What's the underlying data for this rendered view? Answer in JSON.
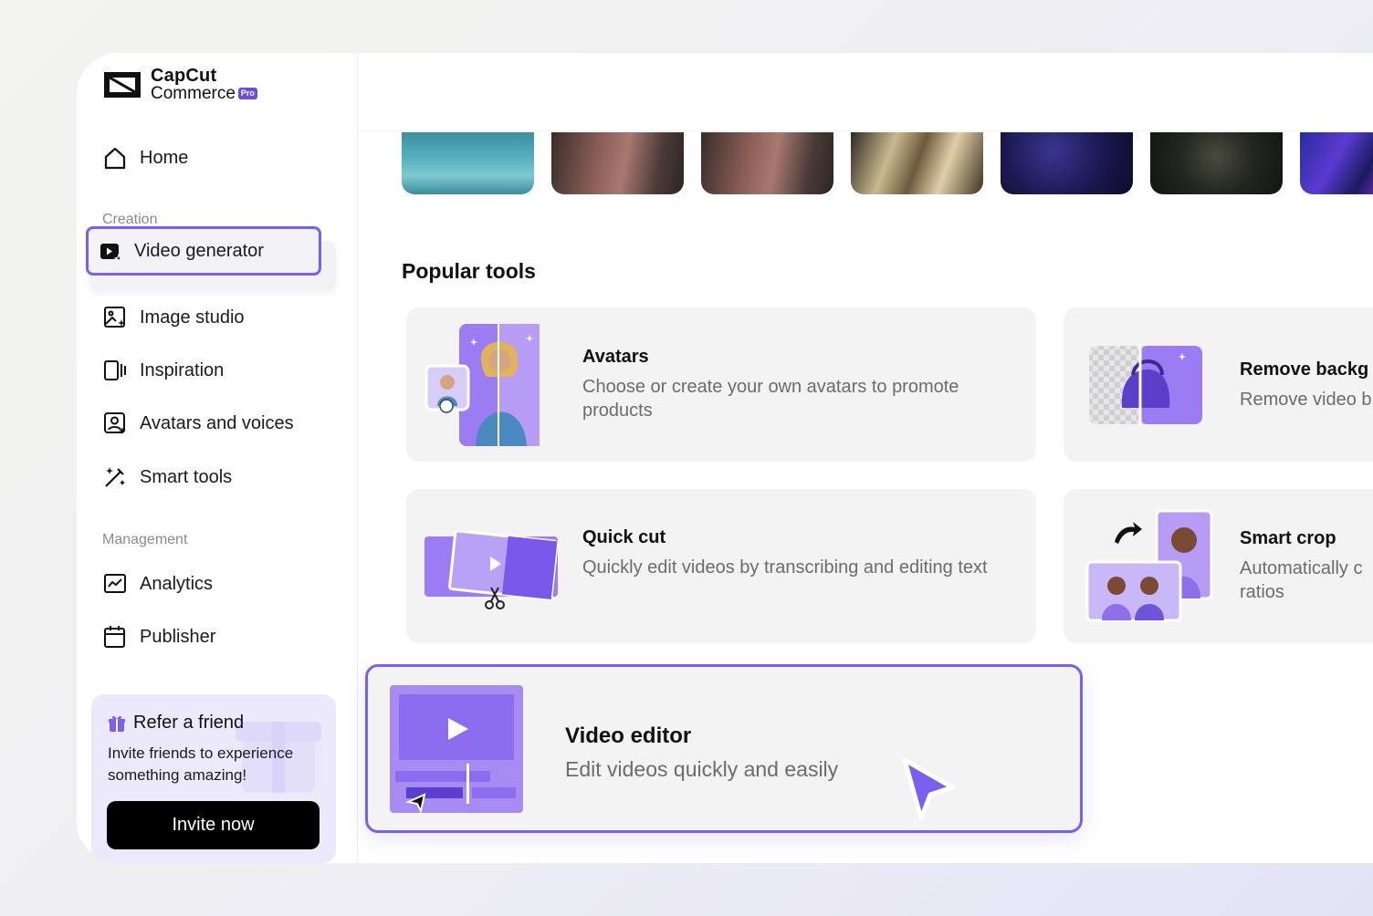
{
  "brand": {
    "line1": "CapCut",
    "line2": "Commerce",
    "badge": "Pro"
  },
  "nav": {
    "home": "Home",
    "creation_label": "Creation",
    "video_generator": "Video generator",
    "image_studio": "Image studio",
    "inspiration": "Inspiration",
    "avatars_voices": "Avatars and voices",
    "smart_tools": "Smart tools",
    "management_label": "Management",
    "analytics": "Analytics",
    "publisher": "Publisher"
  },
  "refer": {
    "title": "Refer a friend",
    "description": "Invite friends to experience something amazing!",
    "button": "Invite now"
  },
  "main": {
    "popular_title": "Popular tools",
    "tools": [
      {
        "name": "Avatars",
        "description": "Choose or create your own avatars to promote products"
      },
      {
        "name": "Remove backg",
        "description": "Remove video b"
      },
      {
        "name": "Quick cut",
        "description": "Quickly edit videos by transcribing and editing text"
      },
      {
        "name": "Smart crop",
        "description": "Automatically c ratios"
      }
    ],
    "video_editor": {
      "name": "Video editor",
      "description": "Edit videos quickly and easily"
    }
  },
  "colors": {
    "accent": "#7b5ff0",
    "accent_light": "#ece9fc",
    "card_bg": "#f3f3f4"
  }
}
